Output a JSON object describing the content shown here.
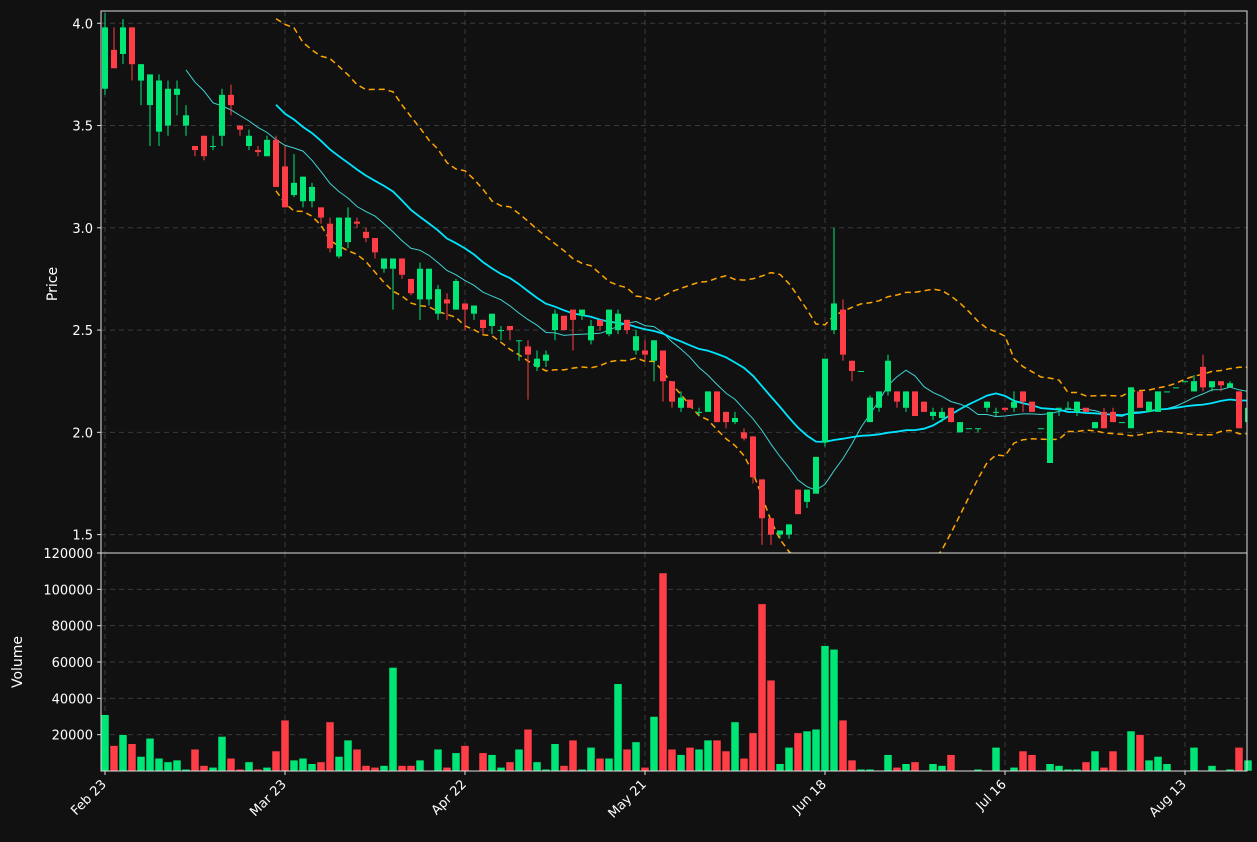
{
  "chart_data": {
    "type": "candlestick",
    "colors": {
      "background": "#111111",
      "up": "#00e676",
      "down": "#ff3d47",
      "ma_fast": "#3fd3d3",
      "ma_slow": "#00e5ff",
      "bollinger": "#ffa500",
      "grid": "#3a3a3a",
      "text": "#ffffff"
    },
    "price_panel": {
      "ylabel": "Price",
      "ylim": [
        1.41,
        4.06
      ],
      "yticks": [
        "1.5",
        "2.0",
        "2.5",
        "3.0",
        "3.5",
        "4.0"
      ],
      "grid": true
    },
    "volume_panel": {
      "ylabel": "Volume",
      "ylim": [
        0,
        120000
      ],
      "yticks": [
        "20000",
        "40000",
        "60000",
        "80000",
        "100000",
        "120000"
      ],
      "grid": true
    },
    "xtick_labels": [
      "Feb 23",
      "Mar 23",
      "Apr 22",
      "May 21",
      "Jun 18",
      "Jul 16",
      "Aug 13"
    ],
    "xtick_index": [
      0,
      20,
      40,
      60,
      80,
      100,
      120
    ],
    "candles": [
      [
        3.68,
        4.05,
        3.65,
        3.98,
        31000
      ],
      [
        3.87,
        3.98,
        3.8,
        3.78,
        14000
      ],
      [
        3.85,
        4.02,
        3.8,
        3.98,
        20000
      ],
      [
        3.98,
        3.98,
        3.72,
        3.8,
        15000
      ],
      [
        3.72,
        3.8,
        3.6,
        3.8,
        8000
      ],
      [
        3.6,
        3.75,
        3.4,
        3.75,
        18000
      ],
      [
        3.47,
        3.75,
        3.4,
        3.72,
        7000
      ],
      [
        3.5,
        3.72,
        3.45,
        3.68,
        5000
      ],
      [
        3.65,
        3.72,
        3.55,
        3.68,
        6000
      ],
      [
        3.5,
        3.6,
        3.45,
        3.55,
        1000
      ],
      [
        3.4,
        3.4,
        3.35,
        3.38,
        12000
      ],
      [
        3.45,
        3.45,
        3.33,
        3.35,
        3000
      ],
      [
        3.4,
        3.45,
        3.38,
        3.4,
        2000
      ],
      [
        3.45,
        3.68,
        3.4,
        3.65,
        19000
      ],
      [
        3.65,
        3.7,
        3.55,
        3.6,
        7000
      ],
      [
        3.5,
        3.5,
        3.45,
        3.48,
        1000
      ],
      [
        3.4,
        3.48,
        3.38,
        3.45,
        5000
      ],
      [
        3.38,
        3.4,
        3.35,
        3.37,
        1000
      ],
      [
        3.35,
        3.45,
        3.35,
        3.43,
        2000
      ],
      [
        3.43,
        3.45,
        3.2,
        3.2,
        11000
      ],
      [
        3.3,
        3.4,
        3.1,
        3.1,
        28000
      ],
      [
        3.16,
        3.36,
        3.15,
        3.22,
        6000
      ],
      [
        3.13,
        3.25,
        3.1,
        3.25,
        7000
      ],
      [
        3.13,
        3.22,
        3.1,
        3.2,
        4000
      ],
      [
        3.1,
        3.1,
        3.02,
        3.05,
        5000
      ],
      [
        3.02,
        3.05,
        2.88,
        2.9,
        27000
      ],
      [
        2.86,
        3.05,
        2.85,
        3.05,
        8000
      ],
      [
        2.93,
        3.1,
        2.9,
        3.05,
        17000
      ],
      [
        3.03,
        3.05,
        3.0,
        3.02,
        12000
      ],
      [
        2.98,
        3.0,
        2.93,
        2.95,
        3000
      ],
      [
        2.95,
        2.95,
        2.85,
        2.88,
        2000
      ],
      [
        2.8,
        2.85,
        2.78,
        2.85,
        3000
      ],
      [
        2.8,
        2.85,
        2.6,
        2.85,
        57000
      ],
      [
        2.85,
        2.85,
        2.75,
        2.77,
        3000
      ],
      [
        2.75,
        2.75,
        2.67,
        2.68,
        3000
      ],
      [
        2.65,
        2.83,
        2.55,
        2.8,
        6000
      ],
      [
        2.65,
        2.8,
        2.62,
        2.8,
        0
      ],
      [
        2.58,
        2.72,
        2.55,
        2.7,
        12000
      ],
      [
        2.65,
        2.68,
        2.55,
        2.63,
        2000
      ],
      [
        2.6,
        2.75,
        2.6,
        2.74,
        10000
      ],
      [
        2.63,
        2.63,
        2.5,
        2.6,
        14000
      ],
      [
        2.58,
        2.62,
        2.55,
        2.62,
        0
      ],
      [
        2.55,
        2.55,
        2.48,
        2.51,
        10000
      ],
      [
        2.52,
        2.58,
        2.48,
        2.58,
        9000
      ],
      [
        2.5,
        2.52,
        2.45,
        2.5,
        2000
      ],
      [
        2.52,
        2.52,
        2.45,
        2.5,
        5000
      ],
      [
        2.45,
        2.45,
        2.35,
        2.45,
        12000
      ],
      [
        2.42,
        2.45,
        2.16,
        2.38,
        23000
      ],
      [
        2.32,
        2.4,
        2.3,
        2.36,
        5000
      ],
      [
        2.35,
        2.4,
        2.32,
        2.38,
        1000
      ],
      [
        2.5,
        2.6,
        2.45,
        2.58,
        15000
      ],
      [
        2.57,
        2.57,
        2.5,
        2.5,
        3000
      ],
      [
        2.6,
        2.6,
        2.4,
        2.55,
        17000
      ],
      [
        2.57,
        2.6,
        2.55,
        2.6,
        1000
      ],
      [
        2.45,
        2.55,
        2.43,
        2.52,
        13000
      ],
      [
        2.55,
        2.55,
        2.5,
        2.52,
        7000
      ],
      [
        2.48,
        2.6,
        2.47,
        2.6,
        7000
      ],
      [
        2.5,
        2.6,
        2.48,
        2.58,
        48000
      ],
      [
        2.55,
        2.55,
        2.48,
        2.5,
        12000
      ],
      [
        2.4,
        2.5,
        2.38,
        2.47,
        16000
      ],
      [
        2.4,
        2.45,
        2.35,
        2.38,
        2000
      ],
      [
        2.35,
        2.45,
        2.25,
        2.45,
        30000
      ],
      [
        2.4,
        2.4,
        2.15,
        2.25,
        109000
      ],
      [
        2.25,
        2.25,
        2.12,
        2.15,
        12000
      ],
      [
        2.12,
        2.2,
        2.1,
        2.17,
        9000
      ],
      [
        2.16,
        2.16,
        2.12,
        2.12,
        13000
      ],
      [
        2.1,
        2.12,
        2.08,
        2.1,
        12000
      ],
      [
        2.1,
        2.2,
        2.1,
        2.2,
        17000
      ],
      [
        2.2,
        2.2,
        2.05,
        2.05,
        17000
      ],
      [
        2.1,
        2.1,
        2.02,
        2.05,
        11000
      ],
      [
        2.05,
        2.1,
        2.04,
        2.07,
        27000
      ],
      [
        2.0,
        2.02,
        1.96,
        1.97,
        7000
      ],
      [
        1.98,
        1.98,
        1.75,
        1.78,
        21000
      ],
      [
        1.77,
        1.77,
        1.45,
        1.58,
        92000
      ],
      [
        1.58,
        1.58,
        1.45,
        1.5,
        50000
      ],
      [
        1.5,
        1.52,
        1.48,
        1.52,
        4000
      ],
      [
        1.5,
        1.55,
        1.48,
        1.55,
        13000
      ],
      [
        1.72,
        1.72,
        1.6,
        1.6,
        21000
      ],
      [
        1.66,
        1.72,
        1.63,
        1.72,
        22000
      ],
      [
        1.7,
        1.88,
        1.7,
        1.88,
        23000
      ],
      [
        1.95,
        2.36,
        1.93,
        2.36,
        69000
      ],
      [
        2.5,
        3.0,
        2.48,
        2.63,
        67000
      ],
      [
        2.6,
        2.65,
        2.35,
        2.38,
        28000
      ],
      [
        2.35,
        2.35,
        2.25,
        2.3,
        6000
      ],
      [
        2.3,
        2.3,
        2.3,
        2.3,
        1000
      ],
      [
        2.05,
        2.18,
        2.05,
        2.17,
        1000
      ],
      [
        2.12,
        2.2,
        2.1,
        2.2,
        0
      ],
      [
        2.2,
        2.38,
        2.18,
        2.35,
        9000
      ],
      [
        2.2,
        2.2,
        2.12,
        2.15,
        2000
      ],
      [
        2.12,
        2.2,
        2.1,
        2.2,
        4000
      ],
      [
        2.2,
        2.2,
        2.08,
        2.08,
        5000
      ],
      [
        2.15,
        2.15,
        2.1,
        2.1,
        0
      ],
      [
        2.08,
        2.12,
        2.06,
        2.1,
        4000
      ],
      [
        2.07,
        2.12,
        2.05,
        2.1,
        3000
      ],
      [
        2.12,
        2.12,
        2.05,
        2.05,
        9000
      ],
      [
        2.0,
        2.05,
        2.0,
        2.05,
        0
      ],
      [
        2.02,
        2.02,
        2.02,
        2.02,
        0
      ],
      [
        2.02,
        2.02,
        2.0,
        2.02,
        1000
      ],
      [
        2.12,
        2.15,
        2.1,
        2.15,
        0
      ],
      [
        2.1,
        2.12,
        2.08,
        2.1,
        13000
      ],
      [
        2.12,
        2.12,
        2.1,
        2.11,
        0
      ],
      [
        2.12,
        2.2,
        2.1,
        2.15,
        2000
      ],
      [
        2.2,
        2.2,
        2.1,
        2.15,
        11000
      ],
      [
        2.15,
        2.15,
        2.1,
        2.1,
        9000
      ],
      [
        2.02,
        2.02,
        2.02,
        2.02,
        0
      ],
      [
        1.85,
        2.1,
        1.85,
        2.1,
        4000
      ],
      [
        2.12,
        2.12,
        2.08,
        2.12,
        3000
      ],
      [
        2.12,
        2.15,
        2.12,
        2.12,
        1000
      ],
      [
        2.1,
        2.15,
        2.08,
        2.15,
        1000
      ],
      [
        2.12,
        2.12,
        2.1,
        2.1,
        5000
      ],
      [
        2.02,
        2.05,
        2.02,
        2.05,
        11000
      ],
      [
        2.1,
        2.12,
        2.02,
        2.02,
        2000
      ],
      [
        2.1,
        2.12,
        2.05,
        2.05,
        11000
      ],
      [
        2.05,
        2.05,
        2.05,
        2.05,
        0
      ],
      [
        2.02,
        2.22,
        2.02,
        2.22,
        22000
      ],
      [
        2.2,
        2.2,
        2.12,
        2.12,
        20000
      ],
      [
        2.1,
        2.15,
        2.1,
        2.15,
        6000
      ],
      [
        2.1,
        2.2,
        2.1,
        2.2,
        8000
      ],
      [
        2.2,
        2.2,
        2.2,
        2.2,
        4000
      ],
      [
        2.22,
        2.22,
        2.22,
        2.22,
        0
      ],
      [
        2.25,
        2.25,
        2.25,
        2.25,
        0
      ],
      [
        2.2,
        2.28,
        2.2,
        2.25,
        13000
      ],
      [
        2.32,
        2.38,
        2.2,
        2.22,
        0
      ],
      [
        2.22,
        2.25,
        2.2,
        2.25,
        3000
      ],
      [
        2.25,
        2.25,
        2.2,
        2.23,
        0
      ],
      [
        2.22,
        2.25,
        2.22,
        2.24,
        1000
      ],
      [
        2.2,
        2.2,
        2.02,
        2.02,
        13000
      ],
      [
        2.05,
        2.12,
        2.05,
        2.12,
        6000
      ]
    ]
  }
}
